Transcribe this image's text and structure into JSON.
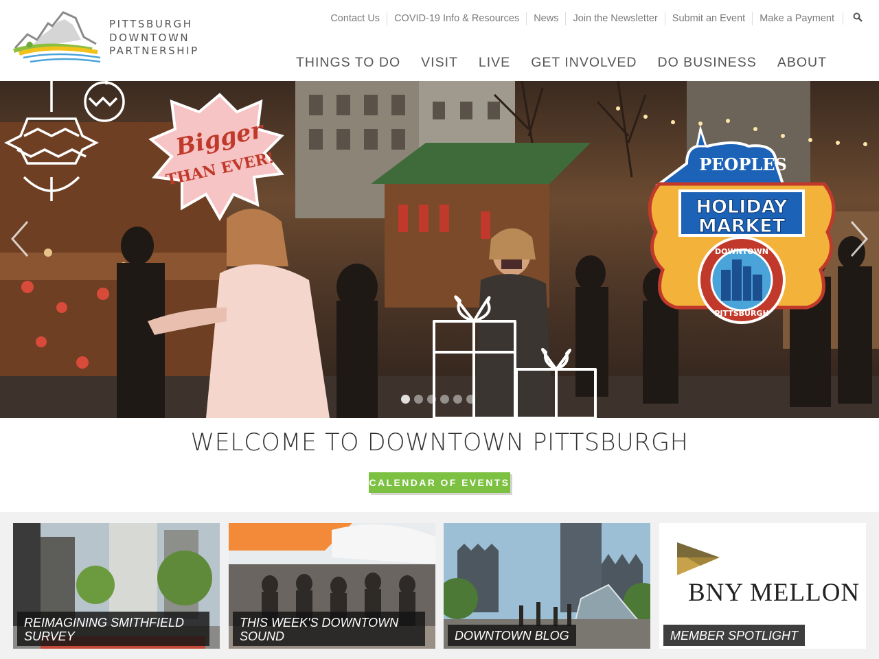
{
  "header": {
    "logo_lines": [
      "PITTSBURGH",
      "DOWNTOWN",
      "PARTNERSHIP"
    ],
    "utility_links": [
      "Contact Us",
      "COVID-19 Info & Resources",
      "News",
      "Join the Newsletter",
      "Submit an Event",
      "Make a Payment"
    ],
    "search_icon": "search-icon",
    "main_nav": [
      "THINGS TO DO",
      "VISIT",
      "LIVE",
      "GET INVOLVED",
      "DO BUSINESS",
      "ABOUT"
    ]
  },
  "hero": {
    "badge_line1": "Bigger",
    "badge_line2": "THAN EVER!",
    "emblem_top": "PEOPLES",
    "emblem_line1": "HOLIDAY",
    "emblem_line2": "MARKET",
    "emblem_ring_top": "DOWNTOWN",
    "emblem_ring_bottom": "PITTSBURGH",
    "slide_count": 6,
    "active_slide": 1
  },
  "welcome": {
    "heading": "WELCOME TO DOWNTOWN PITTSBURGH",
    "cta": "CALENDAR OF EVENTS"
  },
  "tiles": [
    {
      "label": "REIMAGINING SMITHFIELD SURVEY"
    },
    {
      "label": "THIS WEEK'S DOWNTOWN SOUND"
    },
    {
      "label": "DOWNTOWN BLOG"
    },
    {
      "label": "MEMBER SPOTLIGHT",
      "sponsor": "BNY MELLON"
    }
  ],
  "colors": {
    "accent_green": "#7dc142",
    "emblem_blue": "#1c63b8",
    "emblem_red": "#c0392b",
    "badge_pink": "#f6c4c4"
  }
}
